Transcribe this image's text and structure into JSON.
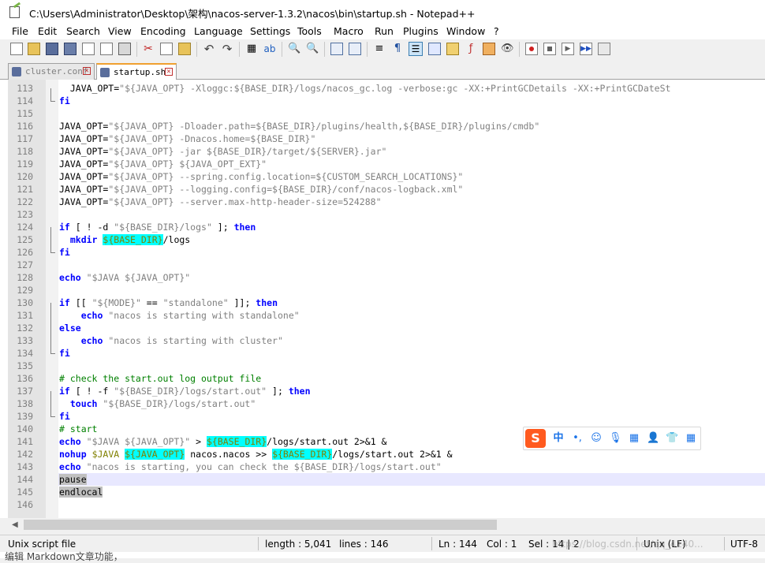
{
  "window": {
    "title": "C:\\Users\\Administrator\\Desktop\\架构\\nacos-server-1.3.2\\nacos\\bin\\startup.sh - Notepad++"
  },
  "menu": [
    "File",
    "Edit",
    "Search",
    "View",
    "Encoding",
    "Language",
    "Settings",
    "Tools",
    "Macro",
    "Run",
    "Plugins",
    "Window",
    "?"
  ],
  "tabs": [
    {
      "label": "cluster.conf",
      "active": false
    },
    {
      "label": "startup.sh",
      "active": true
    }
  ],
  "editor": {
    "current_line": 144,
    "lines": [
      {
        "n": "113",
        "code": "  JAVA_OPT=\"${JAVA_OPT} -Xloggc:${BASE_DIR}/logs/nacos_gc.log -verbose:gc -XX:+PrintGCDetails -XX:+PrintGCDateSt"
      },
      {
        "n": "114",
        "code": "fi"
      },
      {
        "n": "115",
        "code": ""
      },
      {
        "n": "116",
        "code": "JAVA_OPT=\"${JAVA_OPT} -Dloader.path=${BASE_DIR}/plugins/health,${BASE_DIR}/plugins/cmdb\""
      },
      {
        "n": "117",
        "code": "JAVA_OPT=\"${JAVA_OPT} -Dnacos.home=${BASE_DIR}\""
      },
      {
        "n": "118",
        "code": "JAVA_OPT=\"${JAVA_OPT} -jar ${BASE_DIR}/target/${SERVER}.jar\""
      },
      {
        "n": "119",
        "code": "JAVA_OPT=\"${JAVA_OPT} ${JAVA_OPT_EXT}\""
      },
      {
        "n": "120",
        "code": "JAVA_OPT=\"${JAVA_OPT} --spring.config.location=${CUSTOM_SEARCH_LOCATIONS}\""
      },
      {
        "n": "121",
        "code": "JAVA_OPT=\"${JAVA_OPT} --logging.config=${BASE_DIR}/conf/nacos-logback.xml\""
      },
      {
        "n": "122",
        "code": "JAVA_OPT=\"${JAVA_OPT} --server.max-http-header-size=524288\""
      },
      {
        "n": "123",
        "code": ""
      },
      {
        "n": "124",
        "code": "if [ ! -d \"${BASE_DIR}/logs\" ]; then"
      },
      {
        "n": "125",
        "code": "  mkdir ${BASE_DIR}/logs"
      },
      {
        "n": "126",
        "code": "fi"
      },
      {
        "n": "127",
        "code": ""
      },
      {
        "n": "128",
        "code": "echo \"$JAVA ${JAVA_OPT}\""
      },
      {
        "n": "129",
        "code": ""
      },
      {
        "n": "130",
        "code": "if [[ \"${MODE}\" == \"standalone\" ]]; then"
      },
      {
        "n": "131",
        "code": "    echo \"nacos is starting with standalone\""
      },
      {
        "n": "132",
        "code": "else"
      },
      {
        "n": "133",
        "code": "    echo \"nacos is starting with cluster\""
      },
      {
        "n": "134",
        "code": "fi"
      },
      {
        "n": "135",
        "code": ""
      },
      {
        "n": "136",
        "code": "# check the start.out log output file"
      },
      {
        "n": "137",
        "code": "if [ ! -f \"${BASE_DIR}/logs/start.out\" ]; then"
      },
      {
        "n": "138",
        "code": "  touch \"${BASE_DIR}/logs/start.out\""
      },
      {
        "n": "139",
        "code": "fi"
      },
      {
        "n": "140",
        "code": "# start"
      },
      {
        "n": "141",
        "code": "echo \"$JAVA ${JAVA_OPT}\" > ${BASE_DIR}/logs/start.out 2>&1 &"
      },
      {
        "n": "142",
        "code": "nohup $JAVA ${JAVA_OPT} nacos.nacos >> ${BASE_DIR}/logs/start.out 2>&1 &"
      },
      {
        "n": "143",
        "code": "echo \"nacos is starting, you can check the ${BASE_DIR}/logs/start.out\""
      },
      {
        "n": "144",
        "code": "pause"
      },
      {
        "n": "145",
        "code": "endlocal"
      },
      {
        "n": "146",
        "code": ""
      }
    ]
  },
  "status": {
    "file_type": "Unix script file",
    "length": "length : 5,041",
    "lines": "lines : 146",
    "ln": "Ln : 144",
    "col": "Col : 1",
    "sel": "Sel : 14 | 2",
    "eol": "Unix (LF)",
    "encoding": "UTF-8"
  },
  "watermark": "https://blog.csdn.net/qq_4140...",
  "below_text": "编辑 Markdown文章功能，",
  "colors": {
    "keyword": "#0000ff",
    "string": "#808080",
    "comment": "#008000",
    "variable": "#808000",
    "highlight": "#00ffff",
    "current_line": "#e8e8ff"
  }
}
